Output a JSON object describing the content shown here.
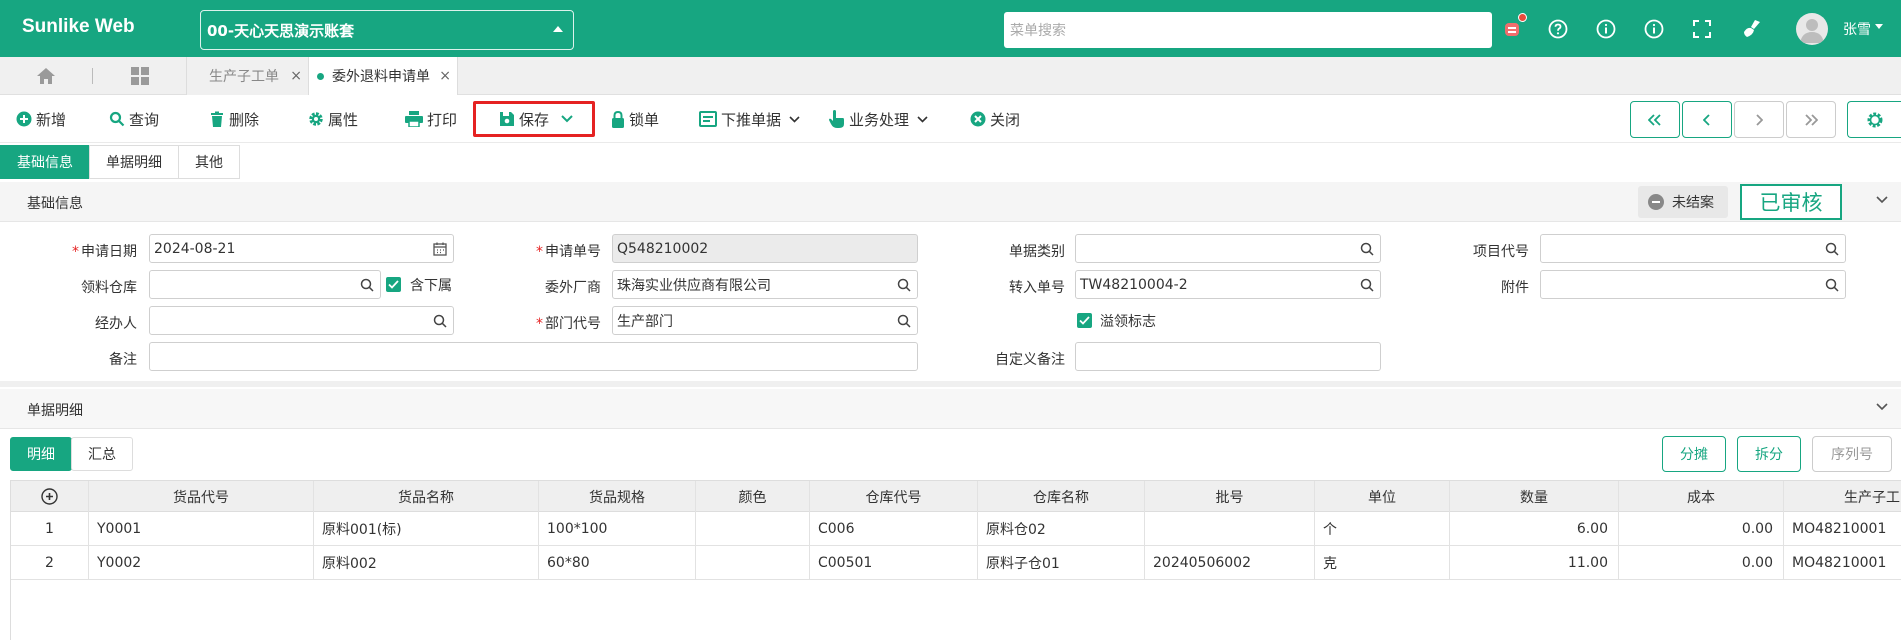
{
  "app": {
    "brand": "Sunlike Web",
    "account": "00-天心天思演示账套",
    "search_placeholder": "菜单搜索",
    "username": "张雪"
  },
  "tabs": [
    {
      "label": "生产子工单",
      "close": "×"
    },
    {
      "label": "委外退料申请单",
      "close": "×"
    }
  ],
  "toolbar": {
    "add": "新增",
    "query": "查询",
    "delete": "删除",
    "props": "属性",
    "print": "打印",
    "save": "保存",
    "lock": "锁单",
    "push": "下推单据",
    "business": "业务处理",
    "close": "关闭"
  },
  "subtabs": [
    "基础信息",
    "单据明细",
    "其他"
  ],
  "basic": {
    "title": "基础信息",
    "status": "未结案",
    "audit": "已审核",
    "fields": {
      "apply_date_label": "申请日期",
      "apply_date": "2024-08-21",
      "apply_no_label": "申请单号",
      "apply_no": "Q548210002",
      "bill_type_label": "单据类别",
      "bill_type": "",
      "project_label": "项目代号",
      "project": "",
      "warehouse_label": "领料仓库",
      "warehouse": "",
      "include_sub_label": "含下属",
      "vendor_label": "委外厂商",
      "vendor": "珠海实业供应商有限公司",
      "transfer_no_label": "转入单号",
      "transfer_no": "TW48210004-2",
      "attach_label": "附件",
      "attach": "",
      "handler_label": "经办人",
      "handler": "",
      "dept_label": "部门代号",
      "dept": "生产部门",
      "overflow_label": "溢领标志",
      "remark_label": "备注",
      "remark": "",
      "custom_remark_label": "自定义备注",
      "custom_remark": ""
    }
  },
  "detail": {
    "title": "单据明细",
    "tabs": [
      "明细",
      "汇总"
    ],
    "buttons": {
      "allocate": "分摊",
      "split": "拆分",
      "serial": "序列号"
    },
    "columns": [
      "货品代号",
      "货品名称",
      "货品规格",
      "颜色",
      "仓库代号",
      "仓库名称",
      "批号",
      "单位",
      "数量",
      "成本",
      "生产子工"
    ],
    "rows": [
      {
        "idx": "1",
        "code": "Y0001",
        "name": "原料001(标)",
        "spec": "100*100",
        "color": "",
        "wh_code": "C006",
        "wh_name": "原料仓02",
        "batch": "",
        "unit": "个",
        "qty": "6.00",
        "cost": "0.00",
        "mo": "MO48210001"
      },
      {
        "idx": "2",
        "code": "Y0002",
        "name": "原料002",
        "spec": "60*80",
        "color": "",
        "wh_code": "C00501",
        "wh_name": "原料子仓01",
        "batch": "20240506002",
        "unit": "克",
        "qty": "11.00",
        "cost": "0.00",
        "mo": "MO48210001"
      }
    ]
  },
  "colors": {
    "accent": "#17a681",
    "highlight": "#e52222"
  }
}
